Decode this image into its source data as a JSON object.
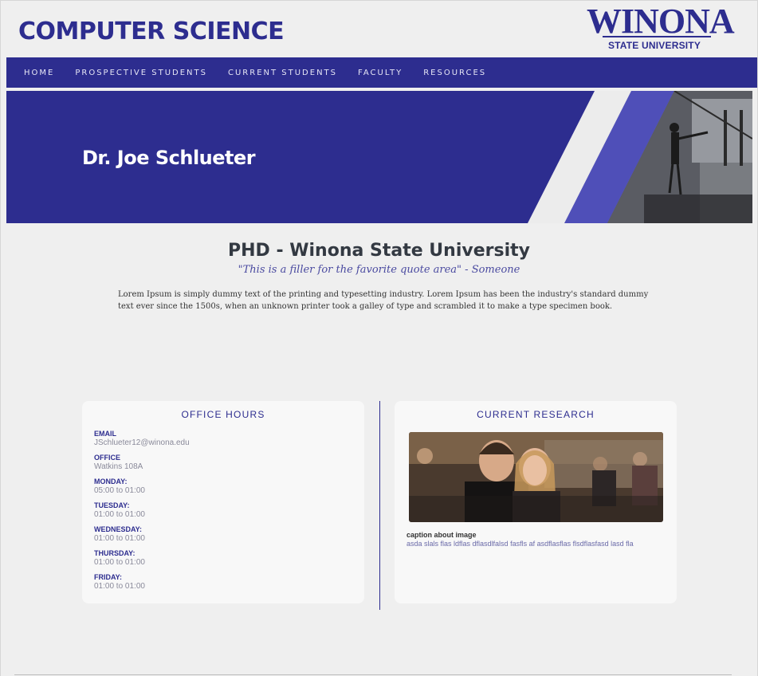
{
  "header": {
    "site_title": "COMPUTER SCIENCE",
    "logo": {
      "word": "WINONA",
      "sub": "STATE UNIVERSITY"
    }
  },
  "nav": {
    "items": [
      "HOME",
      "PROSPECTIVE STUDENTS",
      "CURRENT STUDENTS",
      "FACULTY",
      "RESOURCES"
    ]
  },
  "banner": {
    "name": "Dr. Joe Schlueter"
  },
  "profile": {
    "degree": "PHD - Winona State University",
    "quote": "\"This is a filler for the favorite quote area\" - Someone",
    "bio": "Lorem Ipsum is simply dummy text of the printing and typesetting industry. Lorem Ipsum has been the industry's standard dummy text ever since the 1500s, when an unknown printer took a galley of type and scrambled it to make a type specimen book."
  },
  "office_hours": {
    "title": "OFFICE HOURS",
    "items": [
      {
        "label": "EMAIL",
        "value": "JSchlueter12@winona.edu"
      },
      {
        "label": "OFFICE",
        "value": "Watkins 108A"
      },
      {
        "label": "MONDAY:",
        "value": "05:00 to 01:00"
      },
      {
        "label": "TUESDAY:",
        "value": "01:00 to 01:00"
      },
      {
        "label": "WEDNESDAY:",
        "value": "01:00 to 01:00"
      },
      {
        "label": "THURSDAY:",
        "value": "01:00 to 01:00"
      },
      {
        "label": "FRIDAY:",
        "value": "01:00 to 01:00"
      }
    ]
  },
  "research": {
    "title": "CURRENT RESEARCH",
    "caption_title": "caption about image",
    "caption_text": "asda slals flas ldflas dflasdlfalsd fasfls af asdflasflas flsdflasfasd lasd fla"
  },
  "colors": {
    "brand": "#2d2d8f",
    "accent": "#4f4fb8",
    "background": "#efefef"
  }
}
